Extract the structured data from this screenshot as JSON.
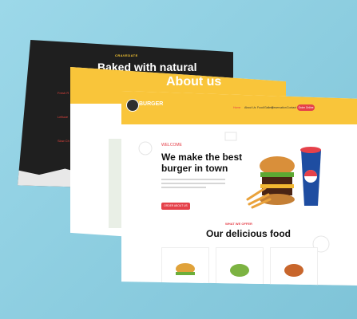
{
  "screen_back": {
    "tag": "CRAVEDATE",
    "title": "Baked with natural",
    "side_items": [
      "Fresh R",
      "Lettuce",
      "Slow Ch"
    ]
  },
  "screen_middle": {
    "title": "About us"
  },
  "screen_front": {
    "brand": "BURGER",
    "menu": [
      "Home",
      "About Us",
      "Food/Gallery",
      "Reservation",
      "Contact Us"
    ],
    "order_button": "Order Online",
    "welcome": "WELCOME",
    "hero_title": "We make the best burger in town",
    "hero_button": "ORDER ABOUT US",
    "offer_label": "WHAT WE OFFER",
    "section_title": "Our delicious food"
  },
  "colors": {
    "accent_red": "#e5414a",
    "brand_yellow": "#f9c53a",
    "background": "#8ecfe2"
  }
}
